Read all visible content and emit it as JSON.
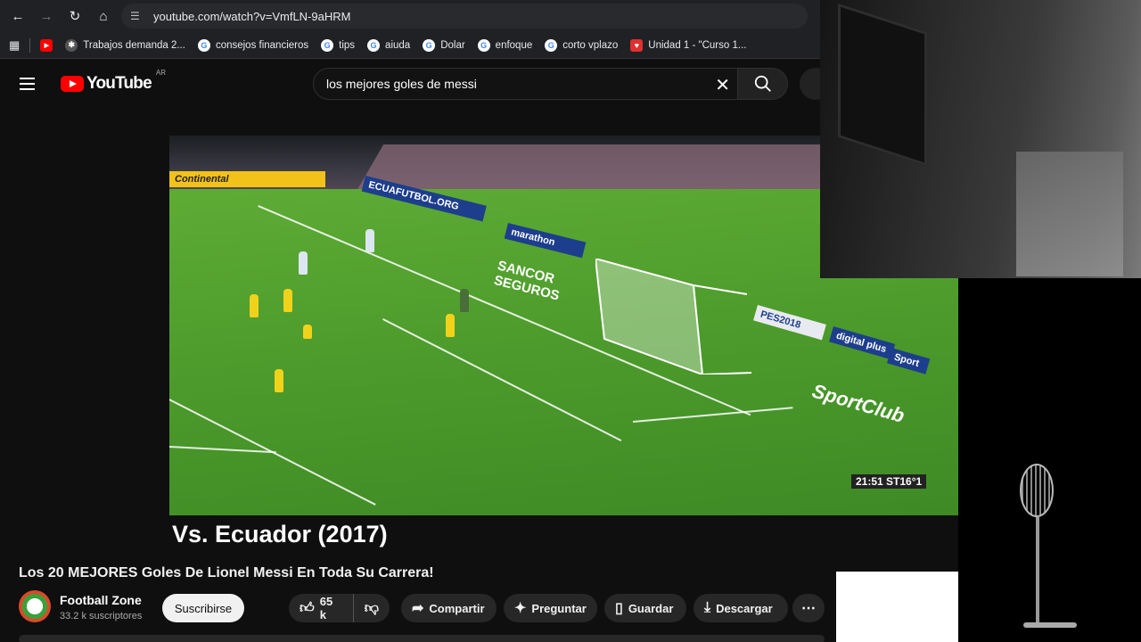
{
  "browser": {
    "url": "youtube.com/watch?v=VmfLN-9aHRM",
    "bookmarks": [
      {
        "label": "Trabajos demanda 2...",
        "icon": "gear-favicon"
      },
      {
        "label": "consejos financieros",
        "icon": "google-favicon"
      },
      {
        "label": "tips",
        "icon": "google-favicon"
      },
      {
        "label": "aiuda",
        "icon": "google-favicon"
      },
      {
        "label": "Dolar",
        "icon": "google-favicon"
      },
      {
        "label": "enfoque",
        "icon": "google-favicon"
      },
      {
        "label": "corto vplazo",
        "icon": "google-favicon"
      },
      {
        "label": "Unidad 1 - \"Curso 1...",
        "icon": "course-favicon"
      }
    ]
  },
  "header": {
    "logo_text": "YouTube",
    "country_code": "AR",
    "search_value": "los mejores goles de messi"
  },
  "video": {
    "caption": "Vs. Ecuador (2017)",
    "timer": "21:51 ST16°1",
    "boards": [
      "Continental",
      "ECUAFUTBOL.ORG",
      "marathon",
      "SANCOR SEGUROS",
      "PES2018",
      "digital plus",
      "Sport",
      "SportClub"
    ]
  },
  "meta": {
    "title": "Los 20 MEJORES Goles De Lionel Messi En Toda Su Carrera!",
    "channel_name": "Football Zone",
    "subscribers": "33.2 k suscriptores",
    "subscribe_label": "Suscribirse",
    "likes": "65 k",
    "share_label": "Compartir",
    "ask_label": "Preguntar",
    "save_label": "Guardar",
    "download_label": "Descargar"
  },
  "colors": {
    "brand_red": "#ff0000",
    "background": "#0f0f0f",
    "pill": "#272727",
    "pitch": "#4c9a2b"
  }
}
